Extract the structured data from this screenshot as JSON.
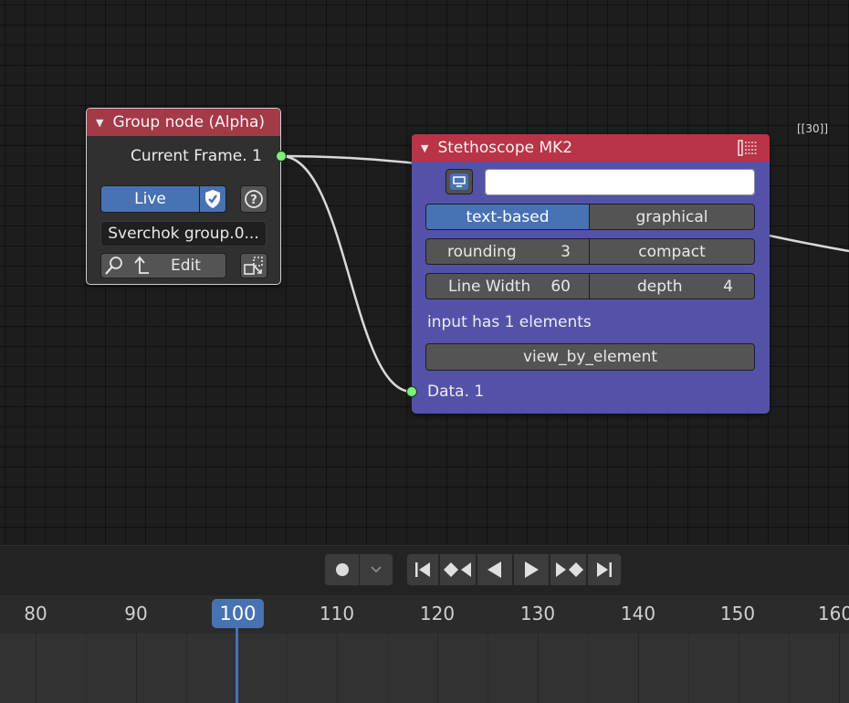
{
  "group_node": {
    "title": "Group node (Alpha)",
    "output_label": "Current Frame. 1",
    "live_label": "Live",
    "group_name": "Sverchok group.0...",
    "edit_label": "Edit"
  },
  "stethoscope_node": {
    "title": "Stethoscope MK2",
    "text_field_value": "",
    "mode_options": [
      "text-based",
      "graphical"
    ],
    "selected_mode": "text-based",
    "rounding_label": "rounding",
    "rounding_value": "3",
    "compact_label": "compact",
    "line_width_label": "Line Width",
    "line_width_value": "60",
    "depth_label": "depth",
    "depth_value": "4",
    "info_text": "input has 1 elements",
    "view_button_label": "view_by_element",
    "input_label": "Data. 1"
  },
  "frame_badge": "[[30]]",
  "timeline": {
    "current_frame": "100",
    "frame_numbers": [
      "80",
      "90",
      "110",
      "120",
      "130",
      "140",
      "150",
      "160"
    ]
  },
  "colors": {
    "node_header_red": "#b83446",
    "stethoscope_body": "#5452a8",
    "accent_blue": "#4772b3",
    "socket_green": "#7fee7a"
  }
}
